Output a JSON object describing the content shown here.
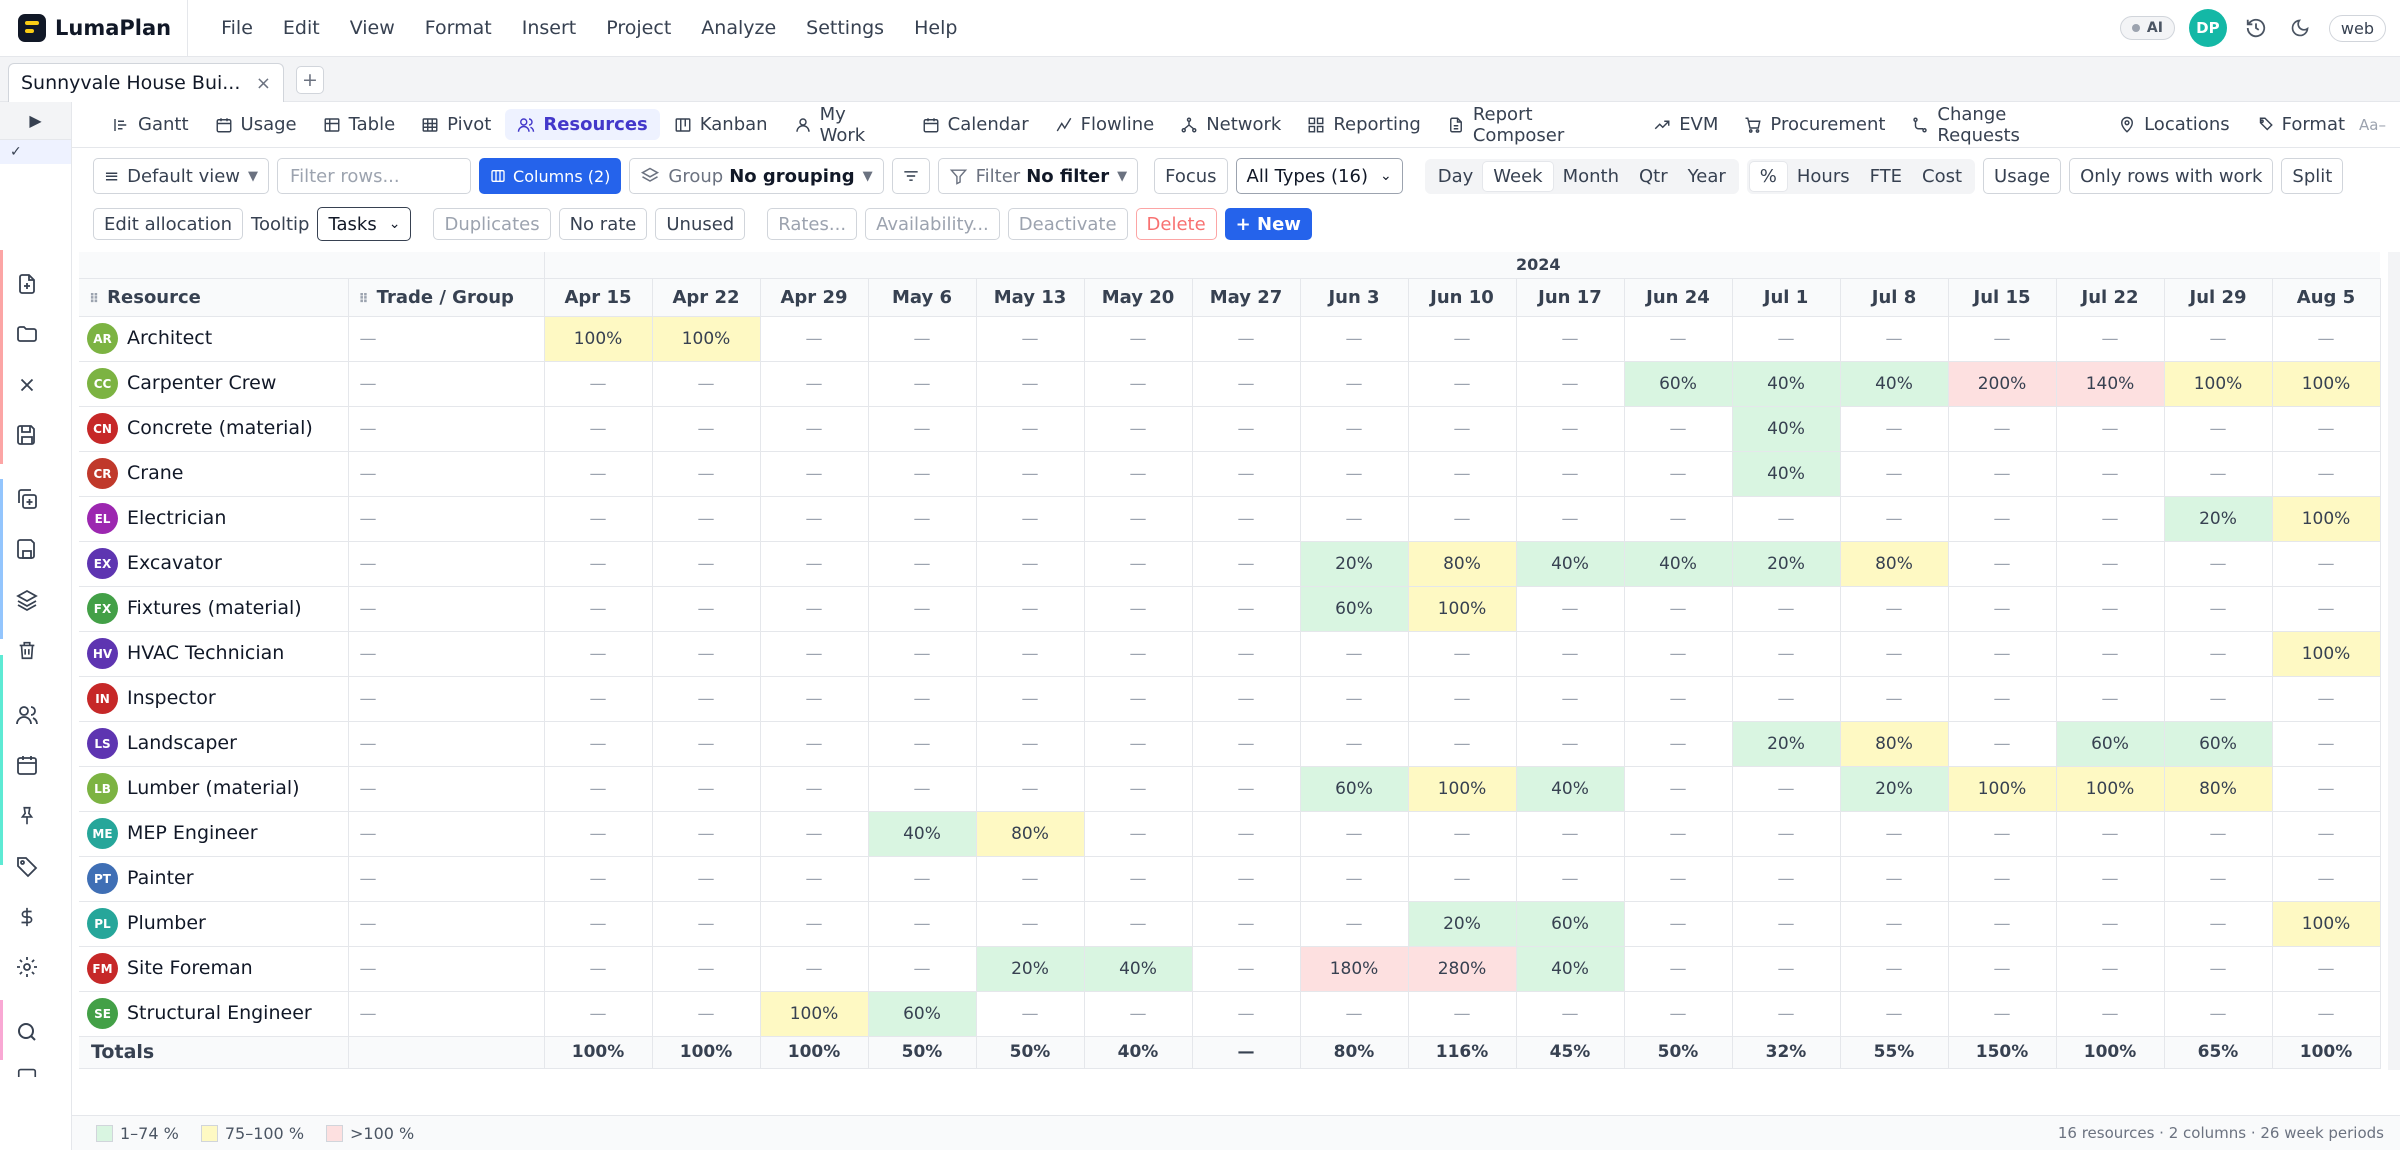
{
  "app": {
    "name": "LumaPlan"
  },
  "menu": [
    "File",
    "Edit",
    "View",
    "Format",
    "Insert",
    "Project",
    "Analyze",
    "Settings",
    "Help"
  ],
  "topright": {
    "ai_label": "AI",
    "avatar": "DP",
    "web_label": "web"
  },
  "project_tab": {
    "title": "Sunnyvale House Bui...",
    "close": "×",
    "add": "+"
  },
  "rail": {
    "collapse": "▶",
    "check": "✓"
  },
  "view_tabs": [
    "Gantt",
    "Usage",
    "Table",
    "Pivot",
    "Resources",
    "Kanban",
    "My Work",
    "Calendar",
    "Flowline",
    "Network",
    "Reporting",
    "Report Composer",
    "EVM",
    "Procurement",
    "Change Requests",
    "Locations",
    "Format"
  ],
  "view_tabs_active": "Resources",
  "font_toggle": "Aa–",
  "toolbar1": {
    "default_view": "Default view",
    "filter_placeholder": "Filter rows...",
    "columns": "Columns (2)",
    "group_label": "Group",
    "group_value": "No grouping",
    "filter_label": "Filter",
    "filter_value": "No filter",
    "focus": "Focus",
    "types": "All Types (16)",
    "period": [
      "Day",
      "Week",
      "Month",
      "Qtr",
      "Year"
    ],
    "period_active": "Week",
    "unit": [
      "%",
      "Hours",
      "FTE",
      "Cost"
    ],
    "unit_active": "%",
    "usage": "Usage",
    "only_rows": "Only rows with work",
    "split": "Split"
  },
  "toolbar2": {
    "edit_allocation": "Edit allocation",
    "tooltip_label": "Tooltip",
    "tooltip_value": "Tasks",
    "duplicates": "Duplicates",
    "no_rate": "No rate",
    "unused": "Unused",
    "rates": "Rates...",
    "availability": "Availability...",
    "deactivate": "Deactivate",
    "delete": "Delete",
    "new": "+ New"
  },
  "grid": {
    "year": "2024",
    "col_resource": "Resource",
    "col_trade": "Trade / Group",
    "weeks": [
      "Apr 15",
      "Apr 22",
      "Apr 29",
      "May 6",
      "May 13",
      "May 20",
      "May 27",
      "Jun 3",
      "Jun 10",
      "Jun 17",
      "Jun 24",
      "Jul 1",
      "Jul 8",
      "Jul 15",
      "Jul 22",
      "Jul 29",
      "Aug 5"
    ],
    "rows": [
      {
        "initials": "AR",
        "name": "Architect",
        "color": "#7cb342",
        "trade": "—",
        "cells": [
          "100%",
          "100%",
          "—",
          "—",
          "—",
          "—",
          "—",
          "—",
          "—",
          "—",
          "—",
          "—",
          "—",
          "—",
          "—",
          "—",
          "—"
        ]
      },
      {
        "initials": "CC",
        "name": "Carpenter Crew",
        "color": "#7cb342",
        "trade": "—",
        "cells": [
          "—",
          "—",
          "—",
          "—",
          "—",
          "—",
          "—",
          "—",
          "—",
          "—",
          "60%",
          "40%",
          "40%",
          "200%",
          "140%",
          "100%",
          "100%"
        ]
      },
      {
        "initials": "CN",
        "name": "Concrete (material)",
        "color": "#c62828",
        "trade": "—",
        "cells": [
          "—",
          "—",
          "—",
          "—",
          "—",
          "—",
          "—",
          "—",
          "—",
          "—",
          "—",
          "40%",
          "—",
          "—",
          "—",
          "—",
          "—"
        ]
      },
      {
        "initials": "CR",
        "name": "Crane",
        "color": "#c0392b",
        "trade": "—",
        "cells": [
          "—",
          "—",
          "—",
          "—",
          "—",
          "—",
          "—",
          "—",
          "—",
          "—",
          "—",
          "40%",
          "—",
          "—",
          "—",
          "—",
          "—"
        ]
      },
      {
        "initials": "EL",
        "name": "Electrician",
        "color": "#9c27b0",
        "trade": "—",
        "cells": [
          "—",
          "—",
          "—",
          "—",
          "—",
          "—",
          "—",
          "—",
          "—",
          "—",
          "—",
          "—",
          "—",
          "—",
          "—",
          "20%",
          "100%"
        ]
      },
      {
        "initials": "EX",
        "name": "Excavator",
        "color": "#5e35b1",
        "trade": "—",
        "cells": [
          "—",
          "—",
          "—",
          "—",
          "—",
          "—",
          "—",
          "20%",
          "80%",
          "40%",
          "40%",
          "20%",
          "80%",
          "—",
          "—",
          "—",
          "—"
        ]
      },
      {
        "initials": "FX",
        "name": "Fixtures (material)",
        "color": "#43a047",
        "trade": "—",
        "cells": [
          "—",
          "—",
          "—",
          "—",
          "—",
          "—",
          "—",
          "60%",
          "100%",
          "—",
          "—",
          "—",
          "—",
          "—",
          "—",
          "—",
          "—"
        ]
      },
      {
        "initials": "HV",
        "name": "HVAC Technician",
        "color": "#5e35b1",
        "trade": "—",
        "cells": [
          "—",
          "—",
          "—",
          "—",
          "—",
          "—",
          "—",
          "—",
          "—",
          "—",
          "—",
          "—",
          "—",
          "—",
          "—",
          "—",
          "100%"
        ]
      },
      {
        "initials": "IN",
        "name": "Inspector",
        "color": "#c62828",
        "trade": "—",
        "cells": [
          "—",
          "—",
          "—",
          "—",
          "—",
          "—",
          "—",
          "—",
          "—",
          "—",
          "—",
          "—",
          "—",
          "—",
          "—",
          "—",
          "—"
        ]
      },
      {
        "initials": "LS",
        "name": "Landscaper",
        "color": "#5e35b1",
        "trade": "—",
        "cells": [
          "—",
          "—",
          "—",
          "—",
          "—",
          "—",
          "—",
          "—",
          "—",
          "—",
          "—",
          "20%",
          "80%",
          "—",
          "60%",
          "60%",
          "—"
        ]
      },
      {
        "initials": "LB",
        "name": "Lumber (material)",
        "color": "#7cb342",
        "trade": "—",
        "cells": [
          "—",
          "—",
          "—",
          "—",
          "—",
          "—",
          "—",
          "60%",
          "100%",
          "40%",
          "—",
          "—",
          "20%",
          "100%",
          "100%",
          "80%",
          "—"
        ]
      },
      {
        "initials": "ME",
        "name": "MEP Engineer",
        "color": "#26a69a",
        "trade": "—",
        "cells": [
          "—",
          "—",
          "—",
          "40%",
          "80%",
          "—",
          "—",
          "—",
          "—",
          "—",
          "—",
          "—",
          "—",
          "—",
          "—",
          "—",
          "—"
        ]
      },
      {
        "initials": "PT",
        "name": "Painter",
        "color": "#3f6fb5",
        "trade": "—",
        "cells": [
          "—",
          "—",
          "—",
          "—",
          "—",
          "—",
          "—",
          "—",
          "—",
          "—",
          "—",
          "—",
          "—",
          "—",
          "—",
          "—",
          "—"
        ]
      },
      {
        "initials": "PL",
        "name": "Plumber",
        "color": "#26a69a",
        "trade": "—",
        "cells": [
          "—",
          "—",
          "—",
          "—",
          "—",
          "—",
          "—",
          "—",
          "20%",
          "60%",
          "—",
          "—",
          "—",
          "—",
          "—",
          "—",
          "100%"
        ]
      },
      {
        "initials": "FM",
        "name": "Site Foreman",
        "color": "#c62828",
        "trade": "—",
        "cells": [
          "—",
          "—",
          "—",
          "—",
          "20%",
          "40%",
          "—",
          "180%",
          "280%",
          "40%",
          "—",
          "—",
          "—",
          "—",
          "—",
          "—",
          "—"
        ]
      },
      {
        "initials": "SE",
        "name": "Structural Engineer",
        "color": "#43a047",
        "trade": "—",
        "cells": [
          "—",
          "—",
          "100%",
          "60%",
          "—",
          "—",
          "—",
          "—",
          "—",
          "—",
          "—",
          "—",
          "—",
          "—",
          "—",
          "—",
          "—"
        ]
      }
    ],
    "totals_label": "Totals",
    "totals": [
      "100%",
      "100%",
      "100%",
      "50%",
      "50%",
      "40%",
      "—",
      "80%",
      "116%",
      "45%",
      "50%",
      "32%",
      "55%",
      "150%",
      "100%",
      "65%",
      "100%"
    ]
  },
  "colors": {
    "low": "#d9f5e1",
    "mid": "#fef9c3",
    "high": "#fde0e0",
    "accent": "#2563eb"
  },
  "legend": [
    "1–74 %",
    "75–100 %",
    ">100 %"
  ],
  "footer_info": "16 resources · 2 columns · 26 week periods"
}
